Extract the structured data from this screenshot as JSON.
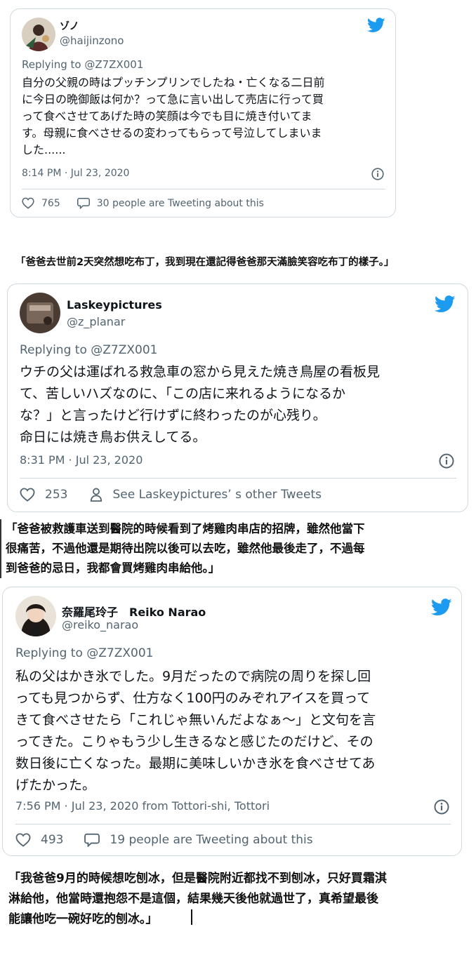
{
  "tweets": [
    {
      "name": "ゾノ",
      "handle": "@haijinzono",
      "reply_label": "Replying to",
      "reply_to": "@Z7ZX001",
      "body": "自分の父親の時はプッチンプリンでしたね・亡くなる二日前\nに今日の晩御飯は何か？って急に言い出して売店に行って買\nって食べさせてあげた時の笑顔は今でも目に焼き付いてま\nす。母親に食べさせるの変わってもらって号泣してしまいま\nした......",
      "timestamp": "8:14 PM · Jul 23, 2020",
      "likes": "765",
      "second_action": "30 people are Tweeting about this",
      "second_icon": "comment-icon"
    },
    {
      "name": "Laskeypictures",
      "handle": "@z_planar",
      "reply_label": "Replying to",
      "reply_to": "@Z7ZX001",
      "body": "ウチの父は運ばれる救急車の窓から見えた焼き鳥屋の看板見\nて、苦しいハズなのに、「この店に来れるようになるか\nな？」と言ったけど行けずに終わったのが心残り。\n命日には焼き鳥お供えしてる。",
      "timestamp": "8:31 PM · Jul 23, 2020",
      "likes": "253",
      "second_action": "See Laskeypictures’ s other Tweets",
      "second_icon": "person-icon"
    },
    {
      "name": "奈羅尾玲子　Reiko Narao",
      "handle": "@reiko_narao",
      "reply_label": "Replying to",
      "reply_to": "@Z7ZX001",
      "body": "私の父はかき氷でした。9月だったので病院の周りを探し回\nっても見つからず、仕方なく100円のみぞれアイスを買って\nきて食べさせたら「これじゃ無いんだよなぁ～」と文句を言\nってきた。こりゃもう少し生きるなと感じたのだけど、その\n数日後に亡くなった。最期に美味しいかき氷を食べさせてあ\nげたかった。",
      "timestamp": "7:56 PM · Jul 23, 2020 from Tottori-shi, Tottori",
      "likes": "493",
      "second_action": "19 people are Tweeting about this",
      "second_icon": "comment-icon"
    }
  ],
  "captions": [
    "「爸爸去世前2天突然想吃布丁，我到現在還記得爸爸那天滿臉笑容吃布丁的樣子。」",
    "「爸爸被救護車送到醫院的時候看到了烤雞肉串店的招牌，雖然他當下\n很痛苦，不過他還是期待出院以後可以去吃，雖然他最後走了，不過每\n到爸爸的忌日，我都會買烤雞肉串給他。」",
    "「我爸爸9月的時候想吃刨冰，但是醫院附近都找不到刨冰，只好買霜淇\n淋給他，他當時還抱怨不是這個，結果幾天後他就過世了，真希望最後\n能讓他吃一碗好吃的刨冰。」"
  ],
  "colors": {
    "twitter_blue": "#1d9bf0",
    "text": "#0f1419",
    "secondary": "#536471",
    "border": "#cfd9de"
  }
}
